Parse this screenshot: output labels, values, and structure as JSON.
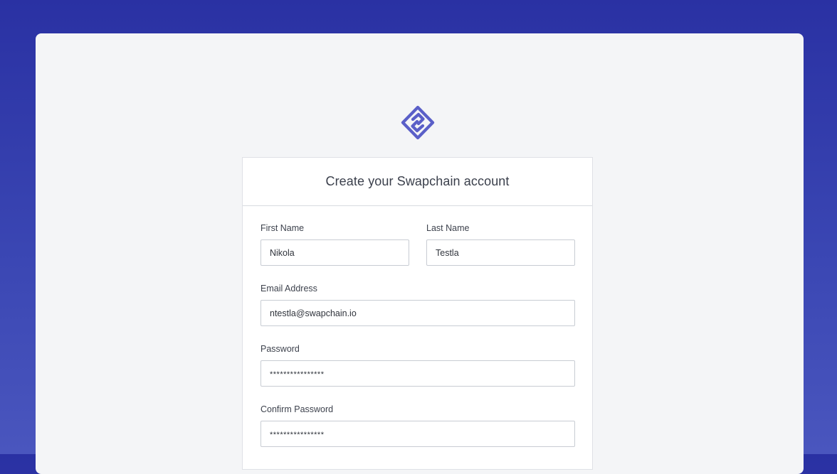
{
  "brand": {
    "logo_icon": "swapchain-logo-icon",
    "accent_color": "#5a5fc8"
  },
  "card": {
    "title": "Create your Swapchain account"
  },
  "form": {
    "first_name": {
      "label": "First Name",
      "value": "Nikola"
    },
    "last_name": {
      "label": "Last Name",
      "value": "Testla"
    },
    "email": {
      "label": "Email Address",
      "value": "ntestla@swapchain.io"
    },
    "password": {
      "label": "Password",
      "value": "****************"
    },
    "confirm_password": {
      "label": "Confirm Password",
      "value": "****************"
    }
  }
}
